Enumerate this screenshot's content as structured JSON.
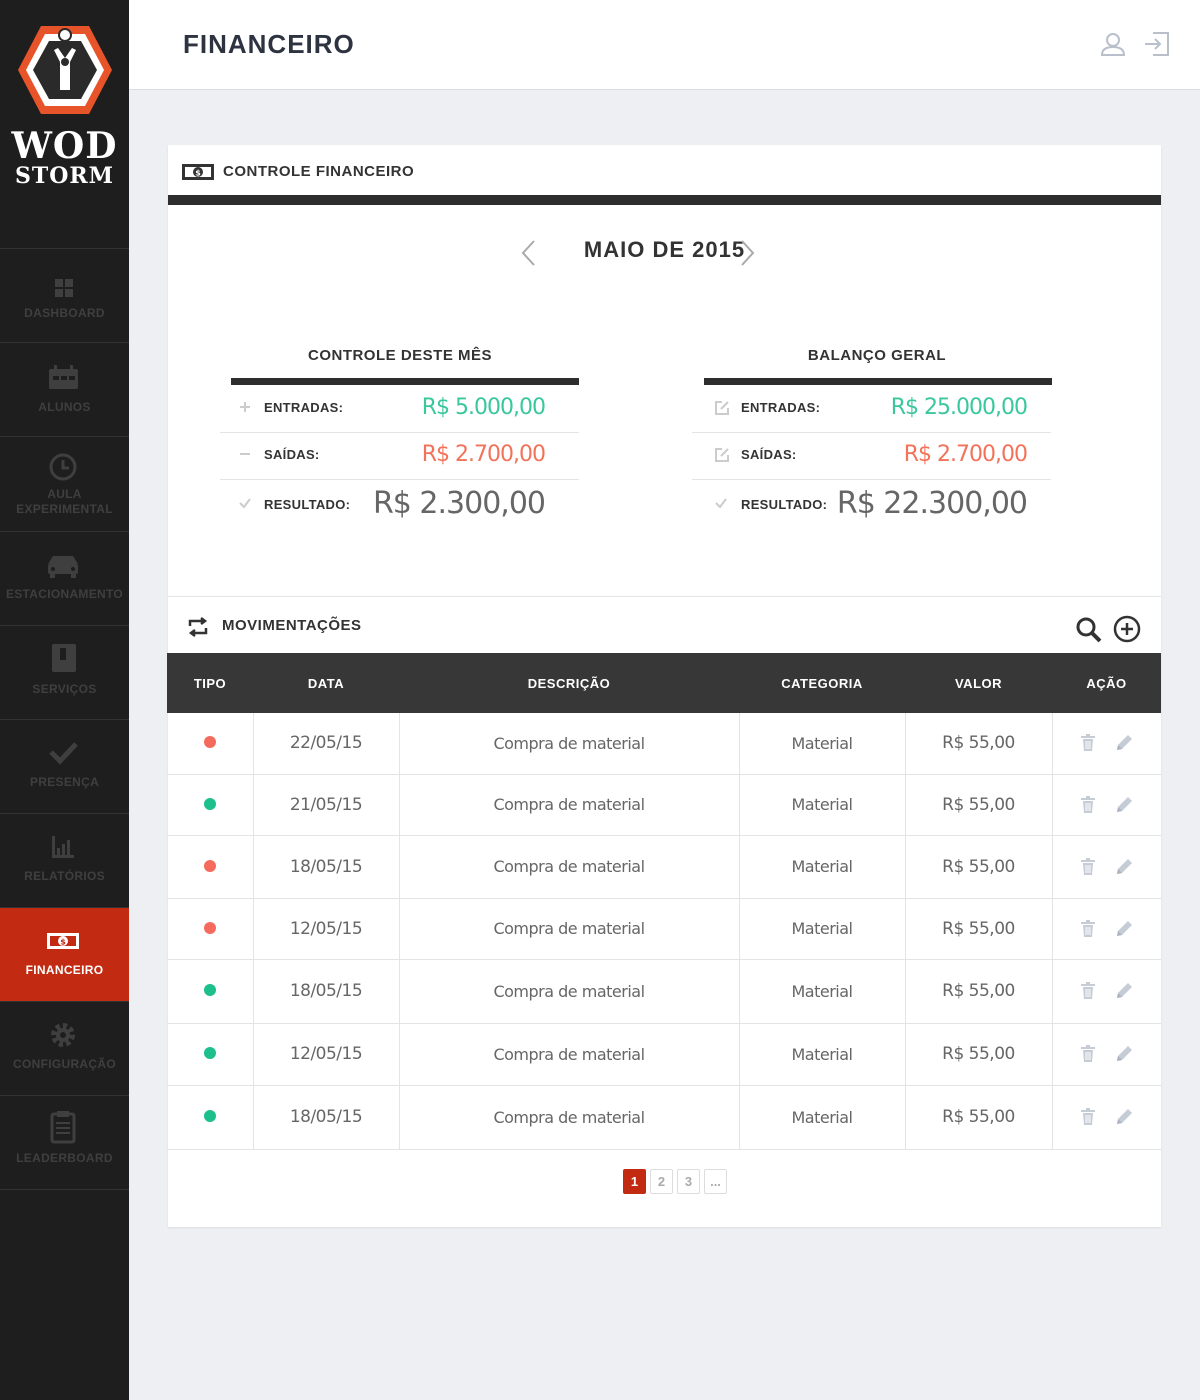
{
  "brand": {
    "line1": "WOD",
    "line2": "STORM"
  },
  "sidebar": {
    "items": [
      {
        "label": "DASHBOARD",
        "icon": "grid-icon"
      },
      {
        "label": "ALUNOS",
        "icon": "calendar-icon"
      },
      {
        "label": "AULA EXPERIMENTAL",
        "icon": "clock-icon"
      },
      {
        "label": "ESTACIONAMENTO",
        "icon": "car-icon"
      },
      {
        "label": "SERVIÇOS",
        "icon": "book-icon"
      },
      {
        "label": "PRESENÇA",
        "icon": "check-icon"
      },
      {
        "label": "RELATÓRIOS",
        "icon": "chart-icon"
      },
      {
        "label": "FINANCEIRO",
        "icon": "money-icon",
        "active": true
      },
      {
        "label": "CONFIGURAÇÃO",
        "icon": "gear-icon"
      },
      {
        "label": "LEADERBOARD",
        "icon": "clipboard-icon"
      }
    ]
  },
  "header": {
    "title": "FINANCEIRO"
  },
  "panel": {
    "title": "CONTROLE FINANCEIRO",
    "month": "MAIO DE 2015",
    "month_summary": {
      "title": "CONTROLE DESTE MÊS",
      "entradas_label": "ENTRADAS:",
      "entradas_value": "R$ 5.000,00",
      "saidas_label": "SAÍDAS:",
      "saidas_value": "R$ 2.700,00",
      "resultado_label": "RESULTADO:",
      "resultado_value": "R$ 2.300,00"
    },
    "general_summary": {
      "title": "BALANÇO GERAL",
      "entradas_label": "ENTRADAS:",
      "entradas_value": "R$ 25.000,00",
      "saidas_label": "SAÍDAS:",
      "saidas_value": "R$ 2.700,00",
      "resultado_label": "RESULTADO:",
      "resultado_value": "R$ 22.300,00"
    }
  },
  "movements": {
    "title": "MOVIMENTAÇÕES",
    "columns": [
      "TIPO",
      "DATA",
      "DESCRIÇÃO",
      "CATEGORIA",
      "VALOR",
      "AÇÃO"
    ],
    "rows": [
      {
        "type": "out",
        "date": "22/05/15",
        "description": "Compra de material",
        "category": "Material",
        "value": "R$ 55,00"
      },
      {
        "type": "in",
        "date": "21/05/15",
        "description": "Compra de material",
        "category": "Material",
        "value": "R$ 55,00"
      },
      {
        "type": "out",
        "date": "18/05/15",
        "description": "Compra de material",
        "category": "Material",
        "value": "R$ 55,00"
      },
      {
        "type": "out",
        "date": "12/05/15",
        "description": "Compra de material",
        "category": "Material",
        "value": "R$ 55,00"
      },
      {
        "type": "in",
        "date": "18/05/15",
        "description": "Compra de material",
        "category": "Material",
        "value": "R$ 55,00"
      },
      {
        "type": "in",
        "date": "12/05/15",
        "description": "Compra de material",
        "category": "Material",
        "value": "R$ 55,00"
      },
      {
        "type": "in",
        "date": "18/05/15",
        "description": "Compra de material",
        "category": "Material",
        "value": "R$ 55,00"
      }
    ]
  },
  "pagination": {
    "pages": [
      "1",
      "2",
      "3",
      "..."
    ],
    "current": "1"
  },
  "colors": {
    "accent": "#c22a12",
    "income": "#1dbf8c",
    "expense": "#f46b5e",
    "sidebar": "#1e1e1e"
  }
}
